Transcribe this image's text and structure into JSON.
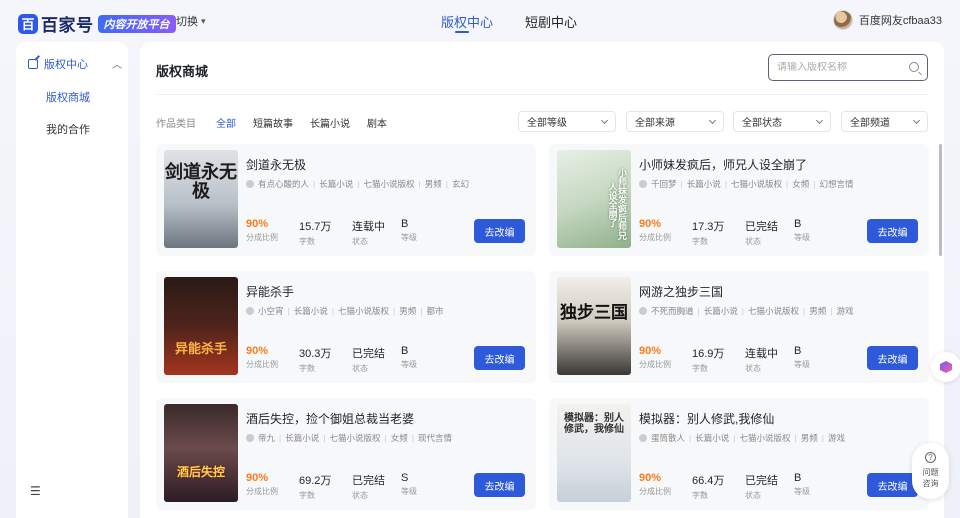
{
  "header": {
    "logo_text": "百家号",
    "logo_badge": "内容开放平台",
    "switch_label": "切换",
    "tabs": [
      {
        "label": "版权中心",
        "active": true
      },
      {
        "label": "短剧中心",
        "active": false
      }
    ],
    "username": "百度网友cfbaa33"
  },
  "sidebar": {
    "group_label": "版权中心",
    "items": [
      {
        "label": "版权商城",
        "active": true
      },
      {
        "label": "我的合作",
        "active": false
      }
    ]
  },
  "main": {
    "title": "版权商城",
    "search_placeholder": "请输入版权名称",
    "filter_label": "作品类目",
    "categories": [
      {
        "label": "全部",
        "active": true
      },
      {
        "label": "短篇故事",
        "active": false
      },
      {
        "label": "长篇小说",
        "active": false
      },
      {
        "label": "剧本",
        "active": false
      }
    ],
    "dropdowns": [
      "全部等级",
      "全部来源",
      "全部状态",
      "全部频道"
    ],
    "stat_labels": {
      "share": "分成比例",
      "words": "字数",
      "status": "状态",
      "grade": "等级"
    },
    "edit_button": "去改编"
  },
  "books": [
    {
      "title": "剑道永无极",
      "author": "有点心酸的人",
      "type": "长篇小说",
      "source": "七猫小说版权",
      "channel": "男频",
      "genre": "玄幻",
      "share": "90%",
      "words": "15.7万",
      "status": "连载中",
      "grade": "B",
      "cover_text": "剑道永无极"
    },
    {
      "title": "小师妹发疯后，师兄人设全崩了",
      "author": "千回梦",
      "type": "长篇小说",
      "source": "七猫小说版权",
      "channel": "女频",
      "genre": "幻想言情",
      "share": "90%",
      "words": "17.3万",
      "status": "已完结",
      "grade": "B",
      "cover_text": "小师妹发疯后师兄人设全崩了"
    },
    {
      "title": "异能杀手",
      "author": "小空宵",
      "type": "长篇小说",
      "source": "七猫小说版权",
      "channel": "男频",
      "genre": "都市",
      "share": "90%",
      "words": "30.3万",
      "status": "已完结",
      "grade": "B",
      "cover_text": "异能杀手"
    },
    {
      "title": "网游之独步三国",
      "author": "不死而胸道",
      "type": "长篇小说",
      "source": "七猫小说版权",
      "channel": "男频",
      "genre": "游戏",
      "share": "90%",
      "words": "16.9万",
      "status": "连载中",
      "grade": "B",
      "cover_text": "独步三国"
    },
    {
      "title": "酒后失控，捡个御姐总裁当老婆",
      "author": "帝九",
      "type": "长篇小说",
      "source": "七猫小说版权",
      "channel": "女频",
      "genre": "现代言情",
      "share": "90%",
      "words": "69.2万",
      "status": "已完结",
      "grade": "S",
      "cover_text": "酒后失控"
    },
    {
      "title": "模拟器：别人修武,我修仙",
      "author": "蛋筒散人",
      "type": "长篇小说",
      "source": "七猫小说版权",
      "channel": "男频",
      "genre": "游戏",
      "share": "90%",
      "words": "66.4万",
      "status": "已完结",
      "grade": "B",
      "cover_text": "模拟器：别人修武，我修仙"
    }
  ],
  "floating": {
    "help_label": "问题咨询"
  },
  "colors": {
    "accent": "#2e59d9",
    "share_highlight": "#ff7a1a"
  }
}
